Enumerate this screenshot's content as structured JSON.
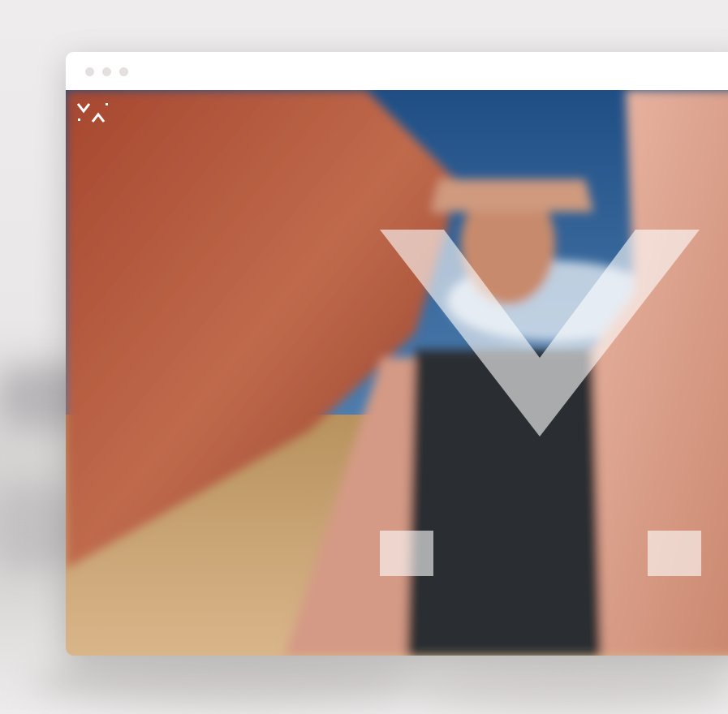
{
  "colors": {
    "background": "#ebe9e9",
    "window": "#ffffff",
    "window_dot": "#e4e0e0",
    "sky": "#2f5f93",
    "sand": "#c9a273",
    "fabric_left": "#b4573d",
    "fabric_right": "#e0a995",
    "dress": "#2a2e33",
    "overlay": "rgba(255,255,255,0.6)"
  },
  "window_controls": [
    "dot-1",
    "dot-2",
    "dot-3"
  ],
  "icons": {
    "logo": "brand-logo-icon",
    "overlay_v": "v-shape-icon",
    "overlay_square": "square-shape-icon"
  }
}
